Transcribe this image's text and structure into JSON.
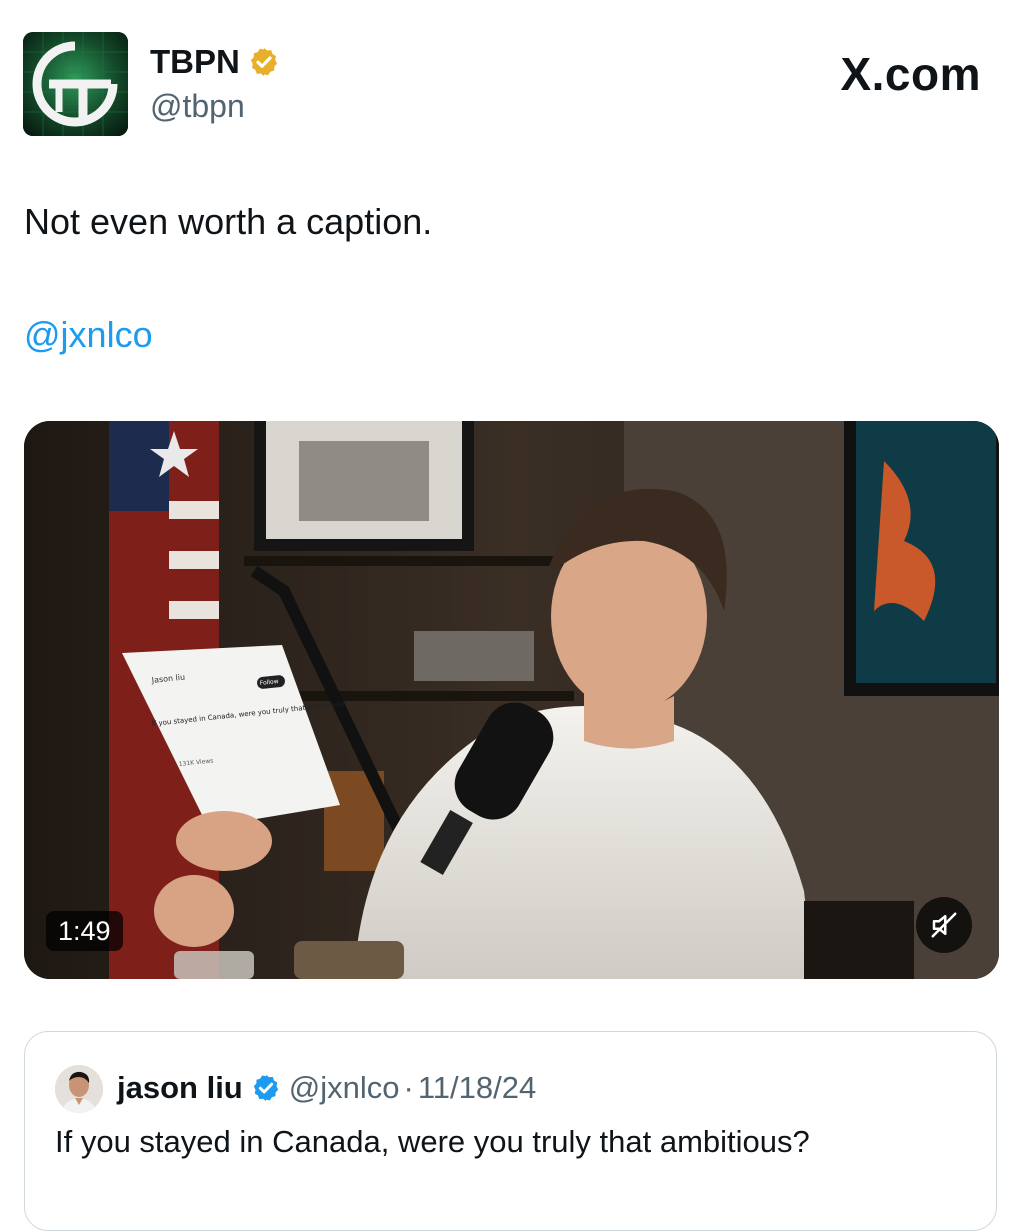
{
  "post": {
    "author_name": "TBPN",
    "handle": "@tbpn",
    "site_label": "X.com",
    "text": "Not even worth a caption.",
    "mention": "@jxnlco",
    "avatar_icon": "tbpn-logo",
    "verified_badge": "gold-verified-badge"
  },
  "video": {
    "duration": "1:49",
    "muted": true,
    "paper_overlay": {
      "name": "Jason liu",
      "handle": "@jxnlco",
      "follow": "Follow",
      "text": "If you stayed in Canada, were you truly that ambitious?",
      "views": "131K Views"
    }
  },
  "quote": {
    "name": "jason liu",
    "handle": "@jxnlco",
    "separator": "·",
    "date": "11/18/24",
    "text": "If you stayed in Canada, were you truly that ambitious?",
    "verified_badge": "blue-verified-badge"
  },
  "colors": {
    "link_blue": "#1d9bf0",
    "gold_badge": "#e8b02a",
    "blue_badge": "#1d9bf0",
    "text_primary": "#0f1419",
    "text_secondary": "#536471",
    "border": "#cfd9de"
  }
}
